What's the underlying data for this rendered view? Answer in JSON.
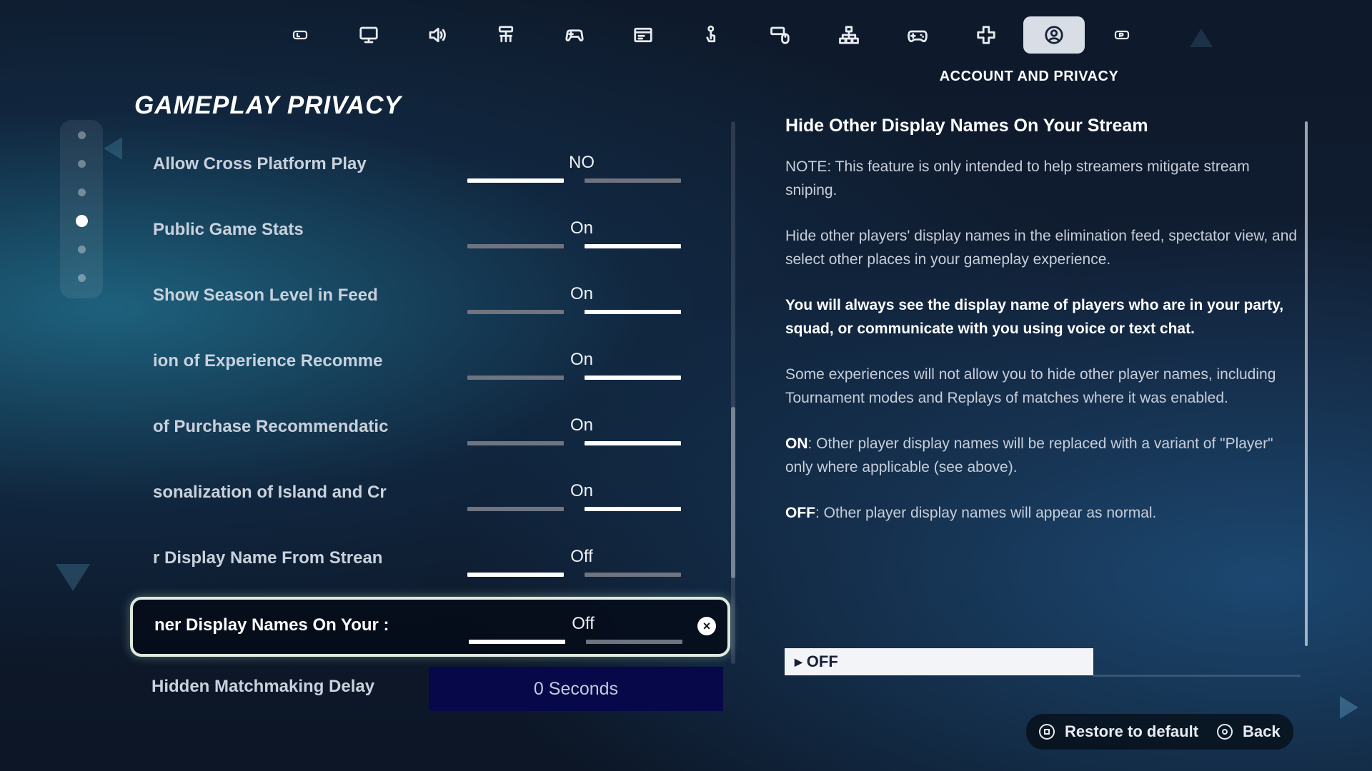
{
  "nav": {
    "active_label": "ACCOUNT AND PRIVACY",
    "tabs": [
      {
        "icon": "lb-bumper-icon"
      },
      {
        "icon": "monitor-icon"
      },
      {
        "icon": "speaker-icon"
      },
      {
        "icon": "accessibility-icon"
      },
      {
        "icon": "controller-config-icon"
      },
      {
        "icon": "hud-icon"
      },
      {
        "icon": "touch-icon"
      },
      {
        "icon": "mouse-keyboard-icon"
      },
      {
        "icon": "network-icon"
      },
      {
        "icon": "gamepad-icon"
      },
      {
        "icon": "dpad-icon"
      },
      {
        "icon": "account-icon",
        "active": true
      },
      {
        "icon": "rb-bumper-icon"
      }
    ]
  },
  "page": {
    "title": "GAMEPLAY PRIVACY"
  },
  "section_nav": {
    "count": 6,
    "active_index": 3
  },
  "settings": [
    {
      "label": "Allow Cross Platform Play",
      "value": "NO",
      "position": "left"
    },
    {
      "label": "Public Game Stats",
      "value": "On",
      "position": "right"
    },
    {
      "label": "Show Season Level in Feed",
      "value": "On",
      "position": "right"
    },
    {
      "label": "ion of Experience Recomme",
      "value": "On",
      "position": "right"
    },
    {
      "label": "of Purchase Recommendatic",
      "value": "On",
      "position": "right"
    },
    {
      "label": "sonalization of Island and Cr",
      "value": "On",
      "position": "right"
    },
    {
      "label": "r Display Name From Strean",
      "value": "Off",
      "position": "left"
    },
    {
      "label": "ner Display Names On Your :",
      "value": "Off",
      "position": "left",
      "selected": true
    }
  ],
  "delay": {
    "label": "Hidden Matchmaking Delay",
    "value": "0 Seconds"
  },
  "description": {
    "title": "Hide Other Display Names On Your Stream",
    "p1": "NOTE: This feature is only intended to help streamers mitigate stream sniping.",
    "p2": "Hide other players' display names in the elimination feed, spectator view, and select other places in your gameplay experience.",
    "p3": "You will always see the display name of players who are in your party, squad, or communicate with you using voice or text chat.",
    "p4": "Some experiences will not allow you to hide other player names, including Tournament modes and Replays of matches where it was enabled.",
    "p5_key": "ON",
    "p5": ": Other player display names will be replaced with a variant of \"Player\" only where applicable (see above).",
    "p6_key": "OFF",
    "p6": ": Other player display names will appear as normal.",
    "current_value": "OFF"
  },
  "footer": {
    "restore_label": "Restore to default",
    "back_label": "Back"
  }
}
